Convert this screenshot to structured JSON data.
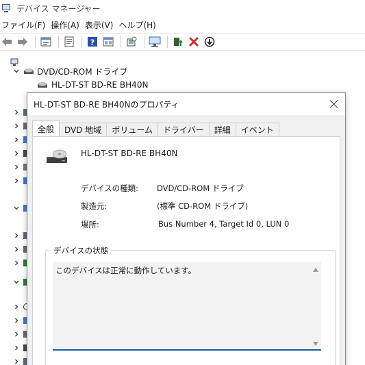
{
  "window": {
    "title": "デバイス マネージャー"
  },
  "menubar": {
    "items": [
      {
        "label": "ファイル(F)"
      },
      {
        "label": "操作(A)"
      },
      {
        "label": "表示(V)"
      },
      {
        "label": "ヘルプ(H)"
      }
    ]
  },
  "toolbar": {
    "icons": [
      "back-arrow-icon",
      "forward-arrow-icon",
      "properties-icon",
      "help-doc-icon",
      "help-icon",
      "view-icon",
      "scan-hardware-icon",
      "monitor-icon",
      "update-driver-icon",
      "uninstall-icon",
      "disable-icon"
    ],
    "colors": {
      "uninstall": "#d62b2b",
      "update": "#1e8a3b",
      "help": "#2a4fa3"
    }
  },
  "tree": {
    "root_icon": "computer-icon",
    "category_label": "DVD/CD-ROM ドライブ",
    "device_label": "HL-DT-ST BD-RE  BH40N"
  },
  "dialog": {
    "title": "HL-DT-ST BD-RE  BH40Nのプロパティ",
    "tabs": [
      {
        "label": "全般",
        "active": true
      },
      {
        "label": "DVD 地域",
        "active": false
      },
      {
        "label": "ボリューム",
        "active": false
      },
      {
        "label": "ドライバー",
        "active": false
      },
      {
        "label": "詳細",
        "active": false
      },
      {
        "label": "イベント",
        "active": false
      }
    ],
    "device_name": "HL-DT-ST BD-RE  BH40N",
    "properties": [
      {
        "label": "デバイスの種類:",
        "value": "DVD/CD-ROM ドライブ"
      },
      {
        "label": "製造元:",
        "value": "(標準 CD-ROM ドライブ)"
      },
      {
        "label": "場所:",
        "value": "Bus Number 4, Target Id 0, LUN 0"
      }
    ],
    "status_group_label": "デバイスの状態",
    "status_text": "このデバイスは正常に動作しています。",
    "accent_color": "#1a5fa8"
  }
}
